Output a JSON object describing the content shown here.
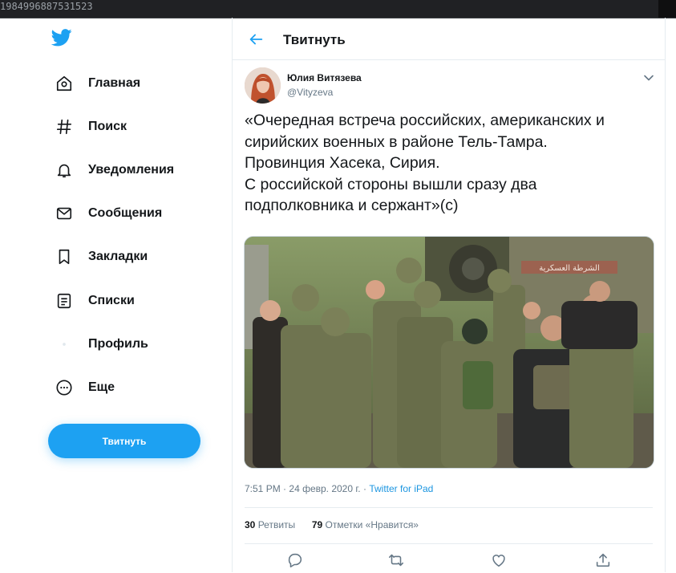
{
  "browser": {
    "url_fragment": "1984996887531523"
  },
  "sidebar": {
    "items": [
      {
        "label": "Главная",
        "icon": "home-icon"
      },
      {
        "label": "Поиск",
        "icon": "hashtag-icon"
      },
      {
        "label": "Уведомления",
        "icon": "bell-icon"
      },
      {
        "label": "Сообщения",
        "icon": "envelope-icon"
      },
      {
        "label": "Закладки",
        "icon": "bookmark-icon"
      },
      {
        "label": "Списки",
        "icon": "list-icon"
      },
      {
        "label": "Профиль",
        "icon": "profile-icon"
      },
      {
        "label": "Еще",
        "icon": "more-icon"
      }
    ],
    "tweet_button_label": "Твитнуть"
  },
  "header": {
    "title": "Твитнуть"
  },
  "tweet": {
    "author_name": "Юлия Витязева",
    "author_handle": "@Vityzeva",
    "text_lines": [
      "«Очередная встреча российских, американских и",
      "сирийских военных в районе Тель-Тамра.",
      "Провинция Хасека, Сирия.",
      "С российской стороны вышли сразу два",
      "подполковника и сержант»(с)"
    ],
    "meta": {
      "time": "7:51 PM",
      "date": "24 февр. 2020 г.",
      "source": "Twitter for iPad"
    },
    "stats": {
      "retweets_count": "30",
      "retweets_label": "Ретвиты",
      "likes_count": "79",
      "likes_label": "Отметки «Нравится»"
    },
    "vehicle_sign_text": "الشرطة العسكرية"
  },
  "colors": {
    "accent": "#1da1f2",
    "link": "#1b95e0",
    "text": "#14171a",
    "secondary": "#657786",
    "border": "#e6ecf0"
  }
}
